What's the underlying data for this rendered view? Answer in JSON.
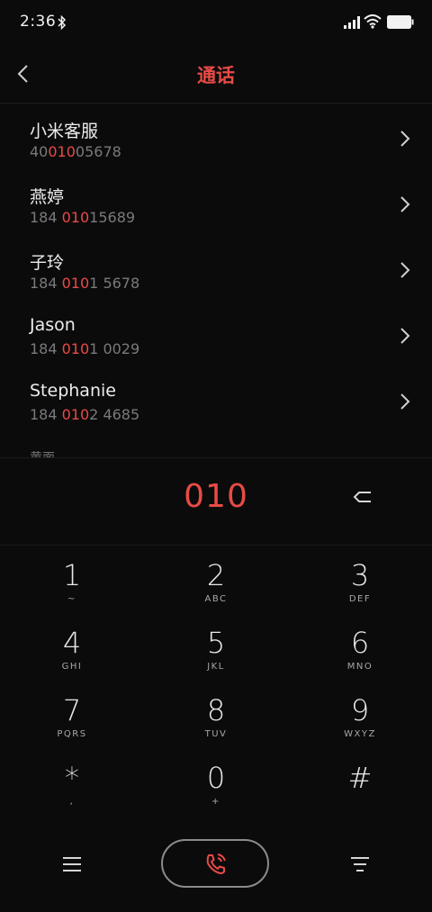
{
  "status_bar": {
    "time": "2:36",
    "icons": [
      "bluetooth-icon",
      "signal-icon",
      "wifi-icon",
      "battery-icon"
    ]
  },
  "header": {
    "title": "通话",
    "back_icon": "chevron-left-icon"
  },
  "colors": {
    "accent": "#e84b46",
    "background": "#0b0b0c",
    "secondary_text": "#7a7a7d"
  },
  "contacts": [
    {
      "name": "小米客服",
      "number_pre": "40",
      "number_match": "010",
      "number_post": "05678"
    },
    {
      "name": "燕婷",
      "number_pre": "184 ",
      "number_match": "010",
      "number_post": "15689"
    },
    {
      "name": "子玲",
      "number_pre": "184 ",
      "number_match": "010",
      "number_post": "1 5678"
    },
    {
      "name": "Jason",
      "number_pre": "184 ",
      "number_match": "010",
      "number_post": "1 0029"
    },
    {
      "name": "Stephanie",
      "number_pre": "184 ",
      "number_match": "010",
      "number_post": "2 4685"
    }
  ],
  "truncated_label": "黄面",
  "dialer": {
    "number": "010",
    "backspace_icon": "backspace-icon"
  },
  "keypad": [
    {
      "digit": "1",
      "letters": "~"
    },
    {
      "digit": "2",
      "letters": "ABC"
    },
    {
      "digit": "3",
      "letters": "DEF"
    },
    {
      "digit": "4",
      "letters": "GHI"
    },
    {
      "digit": "5",
      "letters": "JKL"
    },
    {
      "digit": "6",
      "letters": "MNO"
    },
    {
      "digit": "7",
      "letters": "PQRS"
    },
    {
      "digit": "8",
      "letters": "TUV"
    },
    {
      "digit": "9",
      "letters": "WXYZ"
    },
    {
      "digit": "*",
      "letters": ","
    },
    {
      "digit": "0",
      "letters": "+"
    },
    {
      "digit": "#",
      "letters": ""
    }
  ],
  "bottom_bar": {
    "left_icon": "menu-icon",
    "center_icon": "phone-call-icon",
    "right_icon": "filter-icon"
  }
}
